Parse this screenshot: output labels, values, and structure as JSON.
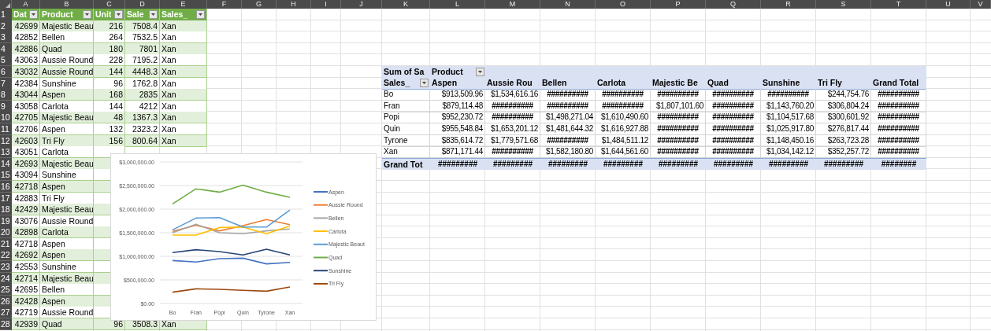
{
  "column_letters": [
    "A",
    "B",
    "C",
    "D",
    "E",
    "F",
    "G",
    "H",
    "I",
    "J",
    "K",
    "L",
    "M",
    "N",
    "O",
    "P",
    "Q",
    "R",
    "S",
    "T",
    "U",
    "V"
  ],
  "row_numbers": [
    "1",
    "2",
    "3",
    "4",
    "5",
    "6",
    "7",
    "8",
    "9",
    "10",
    "11",
    "12",
    "13",
    "14",
    "15",
    "16",
    "17",
    "18",
    "19",
    "20",
    "21",
    "22",
    "23",
    "24",
    "25",
    "26",
    "27",
    "28"
  ],
  "data_table": {
    "columns": [
      "Dat",
      "Product",
      "Unit",
      "Sale",
      "Sales_"
    ],
    "rows": [
      {
        "date": "42699",
        "product": "Majestic Beau",
        "units": "216",
        "sales": "7508.4",
        "rep": "Xan"
      },
      {
        "date": "42852",
        "product": "Bellen",
        "units": "264",
        "sales": "7532.5",
        "rep": "Xan"
      },
      {
        "date": "42886",
        "product": "Quad",
        "units": "180",
        "sales": "7801",
        "rep": "Xan"
      },
      {
        "date": "43063",
        "product": "Aussie Round",
        "units": "228",
        "sales": "7195.2",
        "rep": "Xan"
      },
      {
        "date": "43032",
        "product": "Aussie Round",
        "units": "144",
        "sales": "4448.3",
        "rep": "Xan"
      },
      {
        "date": "42384",
        "product": "Sunshine",
        "units": "96",
        "sales": "1762.8",
        "rep": "Xan"
      },
      {
        "date": "43044",
        "product": "Aspen",
        "units": "168",
        "sales": "2835",
        "rep": "Xan"
      },
      {
        "date": "43058",
        "product": "Carlota",
        "units": "144",
        "sales": "4212",
        "rep": "Xan"
      },
      {
        "date": "42705",
        "product": "Majestic Beau",
        "units": "48",
        "sales": "1367.3",
        "rep": "Xan"
      },
      {
        "date": "42706",
        "product": "Aspen",
        "units": "132",
        "sales": "2323.2",
        "rep": "Xan"
      },
      {
        "date": "42603",
        "product": "Tri Fly",
        "units": "156",
        "sales": "800.64",
        "rep": "Xan"
      },
      {
        "date": "43051",
        "product": "Carlota"
      },
      {
        "date": "42693",
        "product": "Majestic Beau"
      },
      {
        "date": "43094",
        "product": "Sunshine"
      },
      {
        "date": "42718",
        "product": "Aspen"
      },
      {
        "date": "42883",
        "product": "Tri Fly"
      },
      {
        "date": "42429",
        "product": "Majestic Beau"
      },
      {
        "date": "43076",
        "product": "Aussie Round"
      },
      {
        "date": "42898",
        "product": "Carlota"
      },
      {
        "date": "42718",
        "product": "Aspen"
      },
      {
        "date": "42692",
        "product": "Aspen"
      },
      {
        "date": "42553",
        "product": "Sunshine"
      },
      {
        "date": "42714",
        "product": "Majestic Beau"
      },
      {
        "date": "42695",
        "product": "Bellen"
      },
      {
        "date": "42428",
        "product": "Aspen"
      },
      {
        "date": "42719",
        "product": "Aussie Round"
      },
      {
        "date": "42939",
        "product": "Quad",
        "units": "96",
        "sales": "3508.3",
        "rep": "Xan"
      }
    ]
  },
  "pivot_table": {
    "value_label": "Sum of Sa",
    "column_field": "Product",
    "row_field": "Sales_",
    "columns": [
      "Aspen",
      "Aussie Rou",
      "Bellen",
      "Carlota",
      "Majestic Be",
      "Quad",
      "Sunshine",
      "Tri Fly",
      "Grand Total"
    ],
    "rows": [
      {
        "label": "Bo",
        "values": [
          "$913,509.96",
          "$1,534,616.16",
          "##########",
          "##########",
          "##########",
          "##########",
          "##########",
          "$244,754.76",
          "##########"
        ]
      },
      {
        "label": "Fran",
        "values": [
          "$879,114.48",
          "##########",
          "##########",
          "##########",
          "$1,807,101.60",
          "##########",
          "$1,143,760.20",
          "$306,804.24",
          "##########"
        ]
      },
      {
        "label": "Popi",
        "values": [
          "$952,230.72",
          "##########",
          "$1,498,271.04",
          "$1,610,490.60",
          "##########",
          "##########",
          "$1,104,517.68",
          "$300,601.92",
          "##########"
        ]
      },
      {
        "label": "Quin",
        "values": [
          "$955,548.84",
          "$1,653,201.12",
          "$1,481,644.32",
          "$1,616,927.88",
          "##########",
          "##########",
          "$1,025,917.80",
          "$276,817.44",
          "##########"
        ]
      },
      {
        "label": "Tyrone",
        "values": [
          "$835,614.72",
          "$1,779,571.68",
          "##########",
          "$1,484,511.12",
          "##########",
          "##########",
          "$1,148,450.16",
          "$263,723.28",
          "##########"
        ]
      },
      {
        "label": "Xan",
        "values": [
          "$871,171.44",
          "##########",
          "$1,582,180.80",
          "$1,644,561.60",
          "##########",
          "##########",
          "$1,034,142.12",
          "$352,257.72",
          "##########"
        ]
      }
    ],
    "grand_total": {
      "label": "Grand Tot",
      "values": [
        "#########",
        "#########",
        "#########",
        "#########",
        "#########",
        "#########",
        "#########",
        "#########",
        "########"
      ]
    }
  },
  "chart": {
    "chart_data": {
      "type": "line",
      "categories": [
        "Bo",
        "Fran",
        "Popi",
        "Quin",
        "Tyrone",
        "Xan"
      ],
      "ylim": [
        0,
        3000000
      ],
      "grid": true,
      "legend": true,
      "yticks": [
        {
          "value": 0,
          "label": "$0.00"
        },
        {
          "value": 500000,
          "label": "$500,000.00"
        },
        {
          "value": 1000000,
          "label": "$1,000,000.00"
        },
        {
          "value": 1500000,
          "label": "$1,500,000.00"
        },
        {
          "value": 2000000,
          "label": "$2,000,000.00"
        },
        {
          "value": 2500000,
          "label": "$2,500,000.00"
        },
        {
          "value": 3000000,
          "label": "$3,000,000.00"
        }
      ],
      "series": [
        {
          "name": "Aspen",
          "color": "#4472c4",
          "values": [
            910000,
            880000,
            950000,
            960000,
            840000,
            870000
          ]
        },
        {
          "name": "Aussie Round",
          "color": "#ed7d31",
          "values": [
            1530000,
            1660000,
            1540000,
            1650000,
            1780000,
            1670000
          ]
        },
        {
          "name": "Bellen",
          "color": "#a5a5a5",
          "values": [
            1500000,
            1680000,
            1500000,
            1480000,
            1540000,
            1580000
          ]
        },
        {
          "name": "Carlota",
          "color": "#ffc000",
          "values": [
            1450000,
            1450000,
            1610000,
            1620000,
            1480000,
            1640000
          ]
        },
        {
          "name": "Majestic Beaut",
          "color": "#5b9bd5",
          "values": [
            1560000,
            1810000,
            1820000,
            1620000,
            1620000,
            1980000
          ]
        },
        {
          "name": "Quad",
          "color": "#70ad47",
          "values": [
            2110000,
            2430000,
            2360000,
            2510000,
            2360000,
            2250000
          ]
        },
        {
          "name": "Sunshine",
          "color": "#264478",
          "values": [
            1080000,
            1140000,
            1100000,
            1030000,
            1150000,
            1030000
          ]
        },
        {
          "name": "Tri Fly",
          "color": "#9e480e",
          "values": [
            240000,
            310000,
            300000,
            280000,
            260000,
            350000
          ]
        }
      ]
    }
  }
}
